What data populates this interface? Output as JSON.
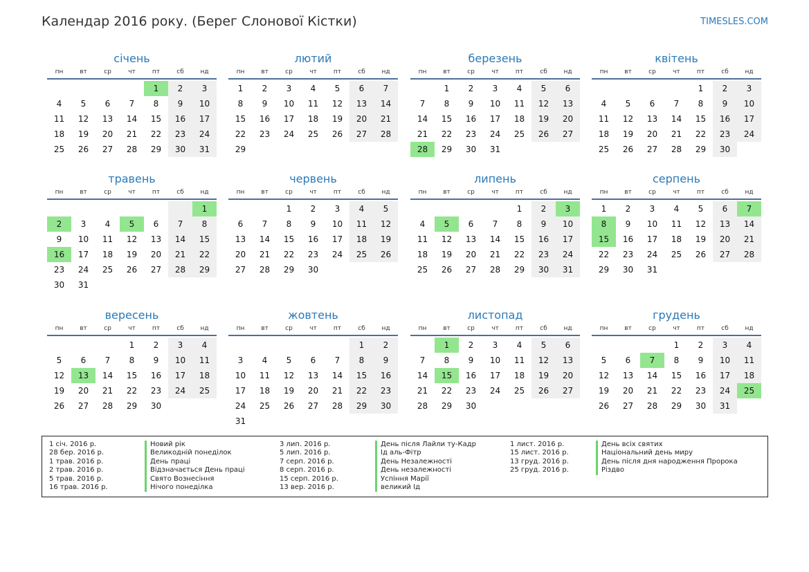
{
  "header": {
    "title": "Календар 2016 року. (Берег Слонової Кістки)",
    "site": "TIMESLES.COM"
  },
  "weekdays": [
    "пн",
    "вт",
    "ср",
    "чт",
    "пт",
    "сб",
    "нд"
  ],
  "months": [
    {
      "name": "січень",
      "offset": 4,
      "days": 31,
      "holidays": [
        1
      ]
    },
    {
      "name": "лютий",
      "offset": 0,
      "days": 29,
      "holidays": []
    },
    {
      "name": "березень",
      "offset": 1,
      "days": 31,
      "holidays": [
        28
      ]
    },
    {
      "name": "квітень",
      "offset": 4,
      "days": 30,
      "holidays": []
    },
    {
      "name": "травень",
      "offset": 6,
      "days": 31,
      "holidays": [
        1,
        2,
        5,
        16
      ]
    },
    {
      "name": "червень",
      "offset": 2,
      "days": 30,
      "holidays": []
    },
    {
      "name": "липень",
      "offset": 4,
      "days": 31,
      "holidays": [
        3,
        5
      ]
    },
    {
      "name": "серпень",
      "offset": 0,
      "days": 31,
      "holidays": [
        7,
        8,
        15
      ]
    },
    {
      "name": "вересень",
      "offset": 3,
      "days": 30,
      "holidays": [
        13
      ]
    },
    {
      "name": "жовтень",
      "offset": 5,
      "days": 31,
      "holidays": []
    },
    {
      "name": "листопад",
      "offset": 1,
      "days": 30,
      "holidays": [
        1,
        15
      ]
    },
    {
      "name": "грудень",
      "offset": 3,
      "days": 31,
      "holidays": [
        7,
        25
      ]
    }
  ],
  "legend": [
    [
      {
        "date": "1 січ. 2016 р.",
        "name": "Новий рік"
      },
      {
        "date": "28 бер. 2016 р.",
        "name": "Великодній понеділок"
      },
      {
        "date": "1 трав. 2016 р.",
        "name": "День праці"
      },
      {
        "date": "2 трав. 2016 р.",
        "name": "Відзначається День праці"
      },
      {
        "date": "5 трав. 2016 р.",
        "name": "Свято Вознесіння"
      },
      {
        "date": "16 трав. 2016 р.",
        "name": "Нічого понеділка"
      }
    ],
    [
      {
        "date": "3 лип. 2016 р.",
        "name": "День після Лайли ту-Кадр"
      },
      {
        "date": "5 лип. 2016 р.",
        "name": "Ід аль-Фітр"
      },
      {
        "date": "7 серп. 2016 р.",
        "name": "День Незалежності"
      },
      {
        "date": "8 серп. 2016 р.",
        "name": "День незалежності"
      },
      {
        "date": "15 серп. 2016 р.",
        "name": "Успіння Марії"
      },
      {
        "date": "13 вер. 2016 р.",
        "name": "великий Ід"
      }
    ],
    [
      {
        "date": "1 лист. 2016 р.",
        "name": "День всіх святих"
      },
      {
        "date": "15 лист. 2016 р.",
        "name": "Національний день миру"
      },
      {
        "date": "13 груд. 2016 р.",
        "name": "День після дня народження Пророка"
      },
      {
        "date": "25 груд. 2016 р.",
        "name": "Різдво"
      }
    ]
  ]
}
